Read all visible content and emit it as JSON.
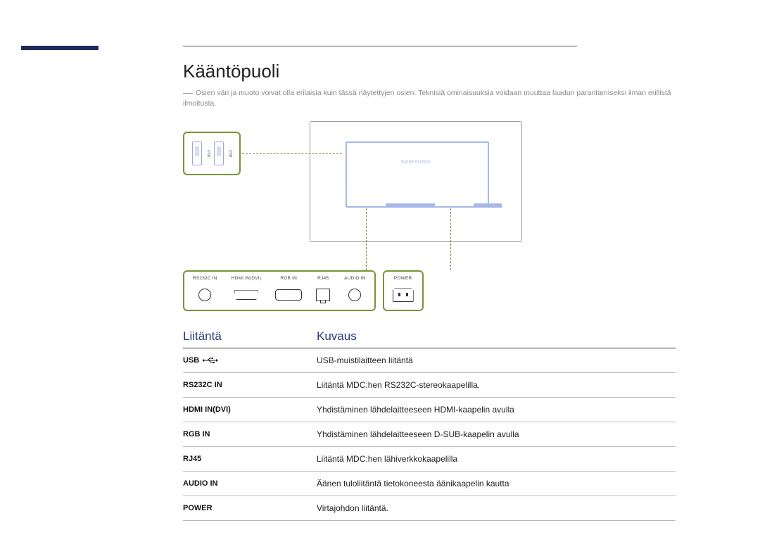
{
  "heading": "Kääntöpuoli",
  "note": "Osien väri ja muoto voivat olla erilaisia kuin tässä näytettyjen osien. Teknisiä ominaisuuksia voidaan muuttaa laadun parantamiseksi ilman erillistä ilmoitusta.",
  "diagram": {
    "brand": "SAMSUNG",
    "usb_side_label_1": "USB",
    "usb_side_label_2": "USB",
    "ports_main": [
      {
        "label": "RS232C IN",
        "icon": "circle"
      },
      {
        "label": "HDMI IN(DVI)",
        "icon": "hdmi"
      },
      {
        "label": "RGB IN",
        "icon": "vga"
      },
      {
        "label": "RJ45",
        "icon": "rj45"
      },
      {
        "label": "AUDIO IN",
        "icon": "circle"
      }
    ],
    "ports_power": [
      {
        "label": "POWER",
        "icon": "power"
      }
    ]
  },
  "table": {
    "header_port": "Liitäntä",
    "header_desc": "Kuvaus",
    "rows": [
      {
        "port": "USB",
        "has_usb_icon": true,
        "desc": "USB-muistilaitteen liitäntä"
      },
      {
        "port": "RS232C IN",
        "desc": "Liitäntä MDC:hen RS232C-stereokaapelilla."
      },
      {
        "port": "HDMI IN(DVI)",
        "desc": "Yhdistäminen lähdelaitteeseen HDMI-kaapelin avulla"
      },
      {
        "port": "RGB IN",
        "desc": "Yhdistäminen lähdelaitteeseen D-SUB-kaapelin avulla"
      },
      {
        "port": "RJ45",
        "desc": "Liitäntä MDC:hen lähiverkkokaapelilla"
      },
      {
        "port": "AUDIO IN",
        "desc": "Äänen tuloliitäntä tietokoneesta äänikaapelin kautta"
      },
      {
        "port": "POWER",
        "desc": "Virtajohdon liitäntä."
      }
    ]
  }
}
